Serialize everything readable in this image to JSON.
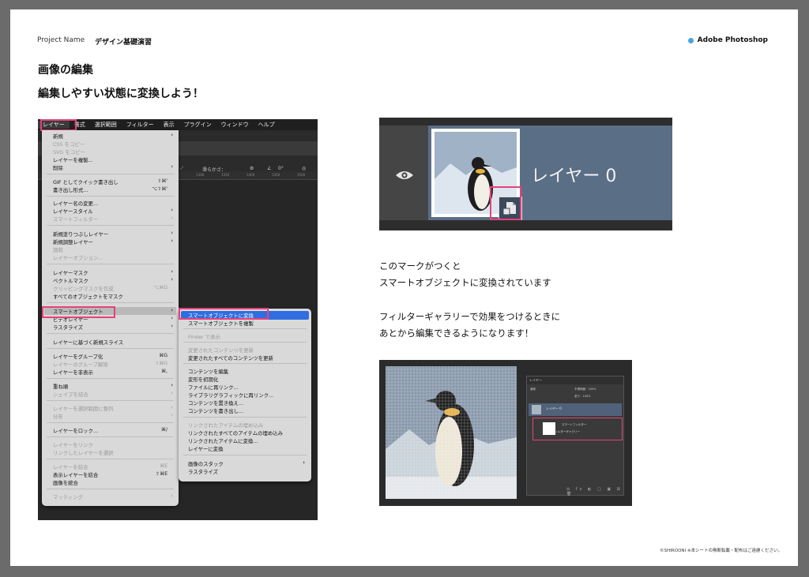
{
  "header": {
    "project_label": "Project Name",
    "project_title": "デザイン基礎演習",
    "app": "Adobe Photoshop",
    "accent_color": "#4aa3df"
  },
  "title": {
    "main": "画像の編集",
    "sub": "編集しやすい状態に変換しよう！"
  },
  "ps_menu": {
    "menubar": [
      "レイヤー",
      "書式",
      "選択範囲",
      "フィルター",
      "表示",
      "プラグイン",
      "ウィンドウ",
      "ヘルプ"
    ],
    "options_smoothness": "滑らかさ：",
    "options_angle": "0°",
    "ruler_numbers": [
      "1300",
      "1350",
      "1400",
      "1450",
      "1500"
    ],
    "items": {
      "new": "新規",
      "copy_css": "CSS をコピー",
      "copy_svg": "SVG をコピー",
      "duplicate": "レイヤーを複製...",
      "delete": "削除",
      "quick_export": "GIF としてクイック書き出し",
      "quick_export_sc": "⇧⌘'",
      "export_as": "書き出し形式...",
      "export_as_sc": "⌥⇧⌘'",
      "rename": "レイヤー名の変更...",
      "style": "レイヤースタイル",
      "smart_filter": "スマートフィルター",
      "new_fill": "新規塗りつぶしレイヤー",
      "new_adjust": "新規調整レイヤー",
      "adjust": "調和",
      "layer_options": "レイヤーオプション...",
      "layer_mask": "レイヤーマスク",
      "vector_mask": "ベクトルマスク",
      "clip_mask": "クリッピングマスクを作成",
      "clip_mask_sc": "⌥⌘G",
      "mask_all": "すべてのオブジェクトをマスク",
      "smart_object": "スマートオブジェクト",
      "video_layer": "ビデオレイヤー",
      "rasterize": "ラスタライズ",
      "slice": "レイヤーに基づく新規スライス",
      "group": "レイヤーをグループ化",
      "group_sc": "⌘G",
      "ungroup": "レイヤーのグループ解除",
      "ungroup_sc": "⇧⌘G",
      "hide": "レイヤーを非表示",
      "hide_sc": "⌘,",
      "arrange": "重ね順",
      "combine_shapes": "シェイプを結合",
      "align_selection": "レイヤーを選択範囲に整列",
      "distribute": "分布",
      "lock": "レイヤーをロック...",
      "lock_sc": "⌘/",
      "link": "レイヤーをリンク",
      "select_linked": "リンクしたレイヤーを選択",
      "merge": "レイヤーを結合",
      "merge_sc": "⌘E",
      "merge_visible": "表示レイヤーを結合",
      "merge_visible_sc": "⇧⌘E",
      "flatten": "画像を統合",
      "matting": "マッティング"
    },
    "submenu": {
      "convert": "スマートオブジェクトに変換",
      "duplicate_new": "スマートオブジェクトを複製",
      "reveal_finder": "Finder で表示",
      "update_modified": "変更されたコンテンツを更新",
      "update_all": "変更されたすべてのコンテンツを更新",
      "edit_contents": "コンテンツを編集",
      "reset_transform": "変形を初期化",
      "relink_file": "ファイルに再リンク...",
      "relink_library": "ライブラリグラフィックに再リンク...",
      "replace_contents": "コンテンツを置き換え...",
      "export_contents": "コンテンツを書き出し...",
      "embed_linked": "リンクされたアイテムの埋め込み",
      "embed_all_linked": "リンクされたすべてのアイテムの埋め込み",
      "convert_to_linked": "リンクされたアイテムに変換...",
      "convert_to_layer": "レイヤーに変換",
      "stack": "画像のスタック",
      "rasterize": "ラスタライズ"
    }
  },
  "layer_panel": {
    "layer_name": "レイヤー 0"
  },
  "explain": {
    "line1": "このマークがつくと",
    "line2": "スマートオブジェクトに変換されています",
    "line3": "フィルターギャラリーで効果をつけるときに",
    "line4": "あとから編集できるようになります！"
  },
  "filter_panel": {
    "tab": "レイヤー",
    "blend": "通常",
    "opacity": "不透明度：100%",
    "fill": "塗り：100%",
    "layer": "レイヤー 0",
    "smart_filter": "スマートフィルター",
    "filter_gallery": "フィルターギャラリー"
  },
  "footer": {
    "copyright": "©SHIROONI ※本シートの無断転載・配布はご遠慮ください。"
  },
  "colors": {
    "highlight_pink": "#e8417a",
    "menu_selected_blue": "#2f6de1",
    "layer_row_blue": "#5a6e86"
  }
}
